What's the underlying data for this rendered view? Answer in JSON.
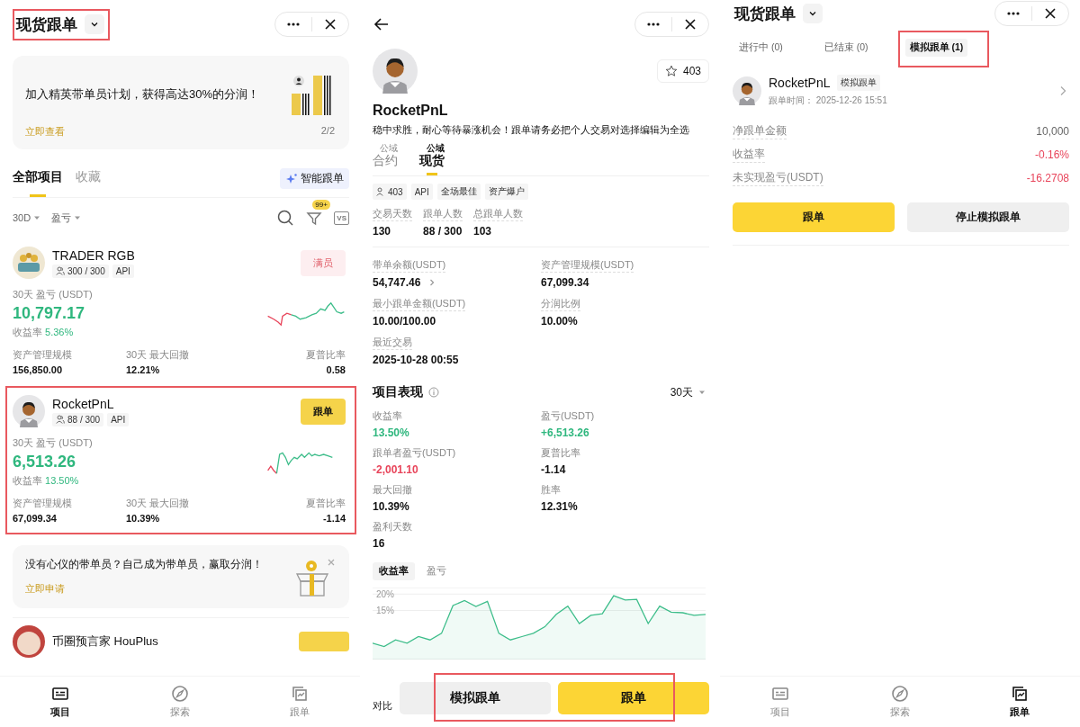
{
  "list_screen": {
    "title": "现货跟单",
    "title_highlighted": true,
    "banner": {
      "text": "加入精英带单员计划，获得高达30%的分润！",
      "link": "立即查看",
      "pager": "2/2"
    },
    "tabs": [
      {
        "label": "全部项目",
        "selected": true
      },
      {
        "label": "收藏",
        "selected": false
      }
    ],
    "smart_button": "智能跟单",
    "filters": [
      "30D",
      "盈亏"
    ],
    "filter_badge": "99+",
    "compare_button": "VS",
    "traders": [
      {
        "name": "TRADER RGB",
        "followers": "300 / 300",
        "tag": "API",
        "action": {
          "label": "满员",
          "kind": "full"
        },
        "pnl_label": "30天 盈亏 (USDT)",
        "pnl": "10,797.17",
        "rate_label": "收益率",
        "rate": "5.36%",
        "stats": [
          {
            "label": "资产管理规模",
            "value": "156,850.00"
          },
          {
            "label": "30天 最大回撤",
            "value": "12.21%"
          },
          {
            "label": "夏普比率",
            "value": "0.58"
          }
        ],
        "highlighted": false
      },
      {
        "name": "RocketPnL",
        "followers": "88 / 300",
        "tag": "API",
        "action": {
          "label": "跟单",
          "kind": "follow"
        },
        "pnl_label": "30天 盈亏 (USDT)",
        "pnl": "6,513.26",
        "rate_label": "收益率",
        "rate": "13.50%",
        "stats": [
          {
            "label": "资产管理规模",
            "value": "67,099.34"
          },
          {
            "label": "30天 最大回撤",
            "value": "10.39%"
          },
          {
            "label": "夏普比率",
            "value": "-1.14"
          }
        ],
        "highlighted": true
      }
    ],
    "promo": {
      "text": "没有心仪的带单员？自己成为带单员，赢取分润！",
      "link": "立即申请"
    },
    "peek_trader": {
      "name": "币圈预言家  HouPlus"
    },
    "nav": [
      {
        "label": "项目",
        "selected": true
      },
      {
        "label": "探索",
        "selected": false
      },
      {
        "label": "跟单",
        "selected": false
      }
    ]
  },
  "detail_screen": {
    "name": "RocketPnL",
    "favorites": "403",
    "bio": "稳中求胜，耐心等待暴涨机会！跟单请务必把个人交易对选择编辑为全选",
    "tabs": [
      {
        "label": "合约",
        "tag": "公域",
        "selected": false
      },
      {
        "label": "现货",
        "tag": "公域",
        "selected": true
      }
    ],
    "badges": [
      {
        "label": "403",
        "kind": "followers"
      },
      {
        "label": "API",
        "kind": "plain"
      },
      {
        "label": "全场最佳",
        "kind": "plain"
      },
      {
        "label": "资产爆户",
        "kind": "plain"
      }
    ],
    "summary": [
      {
        "label": "交易天数",
        "value": "130"
      },
      {
        "label": "跟单人数",
        "value": "88 / 300"
      },
      {
        "label": "总跟单人数",
        "value": "103"
      }
    ],
    "details": [
      {
        "label": "带单余额(USDT)",
        "value": "54,747.46",
        "has_arrow": true
      },
      {
        "label": "资产管理规模(USDT)",
        "value": "67,099.34",
        "has_arrow": false
      },
      {
        "label": "最小跟单金额(USDT)",
        "value": "10.00/100.00",
        "has_arrow": false
      },
      {
        "label": "分润比例",
        "value": "10.00%",
        "has_arrow": false
      },
      {
        "label": "最近交易",
        "value": "2025-10-28 00:55",
        "has_arrow": false
      }
    ],
    "performance": {
      "title": "项目表现",
      "period": "30天",
      "metrics": [
        {
          "label": "收益率",
          "value": "13.50%",
          "kind": "gain"
        },
        {
          "label": "盈亏(USDT)",
          "value": "+6,513.26",
          "kind": "gain"
        },
        {
          "label": "跟单者盈亏(USDT)",
          "value": "-2,001.10",
          "kind": "loss"
        },
        {
          "label": "夏普比率",
          "value": "-1.14",
          "kind": "plain"
        },
        {
          "label": "最大回撤",
          "value": "10.39%",
          "kind": "plain"
        },
        {
          "label": "胜率",
          "value": "12.31%",
          "kind": "plain"
        },
        {
          "label": "盈利天数",
          "value": "16",
          "kind": "plain"
        }
      ],
      "chart_tabs": [
        {
          "label": "收益率",
          "selected": true
        },
        {
          "label": "盈亏",
          "selected": false
        }
      ],
      "chart_data": {
        "type": "area",
        "ylim": [
          0,
          22
        ],
        "yticks": [
          {
            "value": 15,
            "label": "15%"
          },
          {
            "value": 20,
            "label": "20%"
          }
        ],
        "series": [
          {
            "color": "#3dbd8a",
            "values": [
              5,
              4,
              6,
              5,
              7,
              6,
              8,
              16.5,
              18,
              16.2,
              17.8,
              8,
              6,
              7,
              8,
              10,
              13.8,
              16.3,
              11,
              13.5,
              14,
              19.5,
              18.2,
              18.4,
              11,
              16.3,
              14.5,
              14.3,
              13.5,
              13.8
            ]
          }
        ]
      }
    },
    "compare_label": "对比",
    "actions": [
      {
        "label": "模拟跟单",
        "kind": "secondary"
      },
      {
        "label": "跟单",
        "kind": "primary"
      }
    ],
    "actions_highlighted": true
  },
  "copy_screen": {
    "title": "现货跟单",
    "tabs": [
      {
        "label": "进行中 (0)",
        "selected": false,
        "highlighted": false
      },
      {
        "label": "已结束 (0)",
        "selected": false,
        "highlighted": false
      },
      {
        "label": "模拟跟单 (1)",
        "selected": true,
        "highlighted": true
      }
    ],
    "entry": {
      "name": "RocketPnL",
      "tag": "模拟跟单",
      "time_label": "跟单时间：",
      "time": "2025-12-26 15:51",
      "rows": [
        {
          "label": "净跟单金额",
          "value": "10,000",
          "kind": "plain"
        },
        {
          "label": "收益率",
          "value": "-0.16%",
          "kind": "loss"
        },
        {
          "label": "未实现盈亏(USDT)",
          "value": "-16.2708",
          "kind": "loss"
        }
      ],
      "actions": [
        {
          "label": "跟单",
          "kind": "primary"
        },
        {
          "label": "停止模拟跟单",
          "kind": "secondary"
        }
      ]
    },
    "nav": [
      {
        "label": "项目",
        "selected": false
      },
      {
        "label": "探索",
        "selected": false
      },
      {
        "label": "跟单",
        "selected": true
      }
    ]
  }
}
